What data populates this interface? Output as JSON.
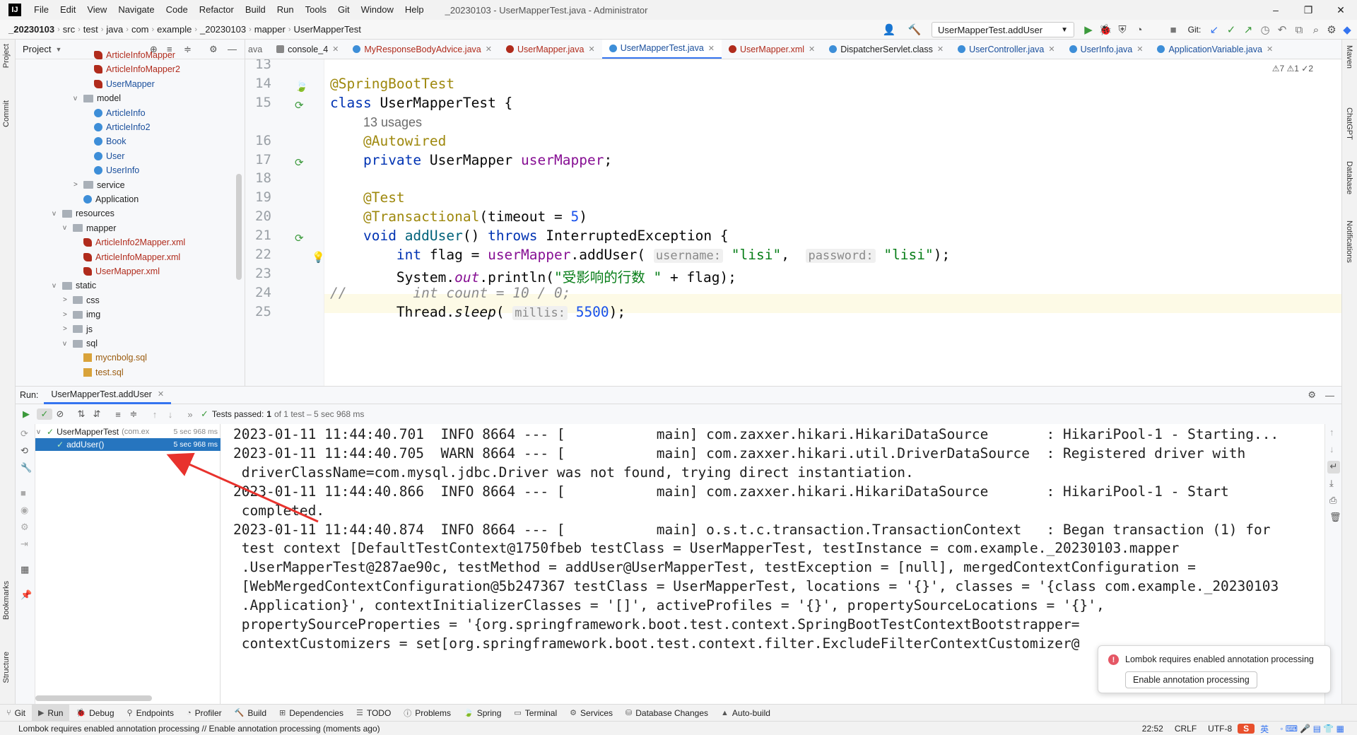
{
  "menubar": {
    "items": [
      "File",
      "Edit",
      "View",
      "Navigate",
      "Code",
      "Refactor",
      "Build",
      "Run",
      "Tools",
      "Git",
      "Window",
      "Help"
    ],
    "title": "_20230103 - UserMapperTest.java - Administrator"
  },
  "navbar": {
    "crumbs": [
      "_20230103",
      "src",
      "test",
      "java",
      "com",
      "example",
      "_20230103",
      "mapper",
      "UserMapperTest"
    ],
    "run_config": "UserMapperTest.addUser",
    "git_label": "Git:"
  },
  "left_strip": {
    "tabs": [
      "Project",
      "Commit",
      "Bookmarks",
      "Structure"
    ]
  },
  "right_strip": {
    "tabs": [
      "Maven",
      "ChatGPT",
      "Database",
      "Notifications"
    ]
  },
  "project": {
    "title": "Project",
    "tree": [
      {
        "label": "ArticleInfoMapper",
        "icon": "mybatis-icon",
        "color": "t-red",
        "indent": 3,
        "caret": ""
      },
      {
        "label": "ArticleInfoMapper2",
        "icon": "mybatis-icon",
        "color": "t-red",
        "indent": 3,
        "caret": ""
      },
      {
        "label": "UserMapper",
        "icon": "mybatis-icon",
        "color": "t-blue",
        "indent": 3,
        "caret": ""
      },
      {
        "label": "model",
        "icon": "folder-icon",
        "color": "",
        "indent": 2,
        "caret": "v"
      },
      {
        "label": "ArticleInfo",
        "icon": "class-icon",
        "color": "t-blue",
        "indent": 3,
        "caret": ""
      },
      {
        "label": "ArticleInfo2",
        "icon": "class-icon",
        "color": "t-blue",
        "indent": 3,
        "caret": ""
      },
      {
        "label": "Book",
        "icon": "class-icon",
        "color": "t-blue",
        "indent": 3,
        "caret": ""
      },
      {
        "label": "User",
        "icon": "class-icon",
        "color": "t-blue",
        "indent": 3,
        "caret": ""
      },
      {
        "label": "UserInfo",
        "icon": "class-icon",
        "color": "t-blue",
        "indent": 3,
        "caret": ""
      },
      {
        "label": "service",
        "icon": "folder-icon",
        "color": "",
        "indent": 2,
        "caret": ">"
      },
      {
        "label": "Application",
        "icon": "class-icon",
        "color": "",
        "indent": 2,
        "caret": ""
      },
      {
        "label": "resources",
        "icon": "folder-icon",
        "color": "",
        "indent": 0,
        "caret": "v"
      },
      {
        "label": "mapper",
        "icon": "folder-icon",
        "color": "",
        "indent": 1,
        "caret": "v"
      },
      {
        "label": "ArticleInfo2Mapper.xml",
        "icon": "mybatis-icon",
        "color": "t-red",
        "indent": 2,
        "caret": ""
      },
      {
        "label": "ArticleInfoMapper.xml",
        "icon": "mybatis-icon",
        "color": "t-red",
        "indent": 2,
        "caret": ""
      },
      {
        "label": "UserMapper.xml",
        "icon": "mybatis-icon",
        "color": "t-red",
        "indent": 2,
        "caret": ""
      },
      {
        "label": "static",
        "icon": "folder-icon",
        "color": "",
        "indent": 0,
        "caret": "v"
      },
      {
        "label": "css",
        "icon": "folder-icon",
        "color": "",
        "indent": 1,
        "caret": ">"
      },
      {
        "label": "img",
        "icon": "folder-icon",
        "color": "",
        "indent": 1,
        "caret": ">"
      },
      {
        "label": "js",
        "icon": "folder-icon",
        "color": "",
        "indent": 1,
        "caret": ">"
      },
      {
        "label": "sql",
        "icon": "folder-icon",
        "color": "",
        "indent": 1,
        "caret": "v"
      },
      {
        "label": "mycnbolg.sql",
        "icon": "sql-icon",
        "color": "t-orange",
        "indent": 2,
        "caret": ""
      },
      {
        "label": "test.sql",
        "icon": "sql-icon",
        "color": "t-orange",
        "indent": 2,
        "caret": ""
      }
    ]
  },
  "editor_tabs": [
    {
      "label": "console_4",
      "active": false
    },
    {
      "label": "MyResponseBodyAdvice.java",
      "active": false
    },
    {
      "label": "UserMapper.java",
      "active": false
    },
    {
      "label": "UserMapperTest.java",
      "active": true
    },
    {
      "label": "UserMapper.xml",
      "active": false
    },
    {
      "label": "DispatcherServlet.class",
      "active": false
    },
    {
      "label": "UserController.java",
      "active": false
    },
    {
      "label": "UserInfo.java",
      "active": false
    },
    {
      "label": "ApplicationVariable.java",
      "active": false
    }
  ],
  "inspections": "⚠7  ⚠1  ✓2",
  "editor": {
    "lines": [
      {
        "n": "13",
        "html": ""
      },
      {
        "n": "14",
        "html": "<span class=\"ann\">@SpringBootTest</span>"
      },
      {
        "n": "15",
        "html": "<span class=\"kw\">class</span> UserMapperTest {"
      },
      {
        "n": "",
        "html": "    <span class=\"usages\">13 usages</span>"
      },
      {
        "n": "16",
        "html": "    <span class=\"ann\">@Autowired</span>"
      },
      {
        "n": "17",
        "html": "    <span class=\"kw\">private</span> UserMapper <span class=\"fld\">userMapper</span>;"
      },
      {
        "n": "18",
        "html": ""
      },
      {
        "n": "19",
        "html": "    <span class=\"ann\">@Test</span>"
      },
      {
        "n": "20",
        "html": "    <span class=\"ann\">@Transactional</span>(timeout = <span class=\"num\">5</span>)"
      },
      {
        "n": "21",
        "html": "    <span class=\"kw\">void</span> <span class=\"fn\">addUser</span>() <span class=\"kw\">throws</span> InterruptedException {"
      },
      {
        "n": "22",
        "html": "        <span class=\"kw\">int</span> flag = <span class=\"fld\">userMapper</span>.addUser( <span class=\"hint\">username:</span> <span class=\"str\">\"lisi\"</span>,  <span class=\"hint\">password:</span> <span class=\"str\">\"lisi\"</span>);"
      },
      {
        "n": "23",
        "html": "        System.<span class=\"fld\" style=\"font-style:italic\">out</span>.println(<span class=\"str\">\"受影响的行数 \"</span> + flag);"
      },
      {
        "n": "24",
        "html": "<span class=\"comment\">//        int count = 10 / 0;</span>"
      },
      {
        "n": "25",
        "html": "        Thread.<span style=\"font-style:italic\">sleep</span>( <span class=\"hint\">millis:</span> <span class=\"num\">5500</span>);"
      }
    ]
  },
  "run": {
    "label": "Run:",
    "tab": "UserMapperTest.addUser",
    "status_prefix": "Tests passed:",
    "status_count": "1",
    "status_suffix": "of 1 test – 5 sec 968 ms",
    "tree": [
      {
        "label": "UserMapperTest",
        "sub": "(com.ex",
        "time": "5 sec 968 ms",
        "selected": false
      },
      {
        "label": "addUser()",
        "sub": "",
        "time": "5 sec 968 ms",
        "selected": true
      }
    ],
    "console": [
      "2023-01-11 11:44:40.701  INFO 8664 --- [           main] com.zaxxer.hikari.HikariDataSource       : HikariPool-1 - Starting...",
      "2023-01-11 11:44:40.705  WARN 8664 --- [           main] com.zaxxer.hikari.util.DriverDataSource  : Registered driver with",
      " driverClassName=com.mysql.jdbc.Driver was not found, trying direct instantiation.",
      "2023-01-11 11:44:40.866  INFO 8664 --- [           main] com.zaxxer.hikari.HikariDataSource       : HikariPool-1 - Start",
      " completed.",
      "2023-01-11 11:44:40.874  INFO 8664 --- [           main] o.s.t.c.transaction.TransactionContext   : Began transaction (1) for",
      " test context [DefaultTestContext@1750fbeb testClass = UserMapperTest, testInstance = com.example._20230103.mapper",
      " .UserMapperTest@287ae90c, testMethod = addUser@UserMapperTest, testException = [null], mergedContextConfiguration =",
      " [WebMergedContextConfiguration@5b247367 testClass = UserMapperTest, locations = '{}', classes = '{class com.example._20230103",
      " .Application}', contextInitializerClasses = '[]', activeProfiles = '{}', propertySourceLocations = '{}',",
      " propertySourceProperties = '{org.springframework.boot.test.context.SpringBootTestContextBootstrapper=",
      " contextCustomizers = set[org.springframework.boot.test.context.filter.ExcludeFilterContextCustomizer@"
    ]
  },
  "notification": {
    "message": "Lombok requires enabled annotation processing",
    "button": "Enable annotation processing"
  },
  "bottom_bar": [
    {
      "label": "Git",
      "icon": "git-icon",
      "active": false
    },
    {
      "label": "Run",
      "icon": "run-icon",
      "active": true
    },
    {
      "label": "Debug",
      "icon": "debug-icon",
      "active": false
    },
    {
      "label": "Endpoints",
      "icon": "endpoints-icon",
      "active": false
    },
    {
      "label": "Profiler",
      "icon": "profiler-icon",
      "active": false
    },
    {
      "label": "Build",
      "icon": "build-icon",
      "active": false
    },
    {
      "label": "Dependencies",
      "icon": "dependencies-icon",
      "active": false
    },
    {
      "label": "TODO",
      "icon": "todo-icon",
      "active": false
    },
    {
      "label": "Problems",
      "icon": "problems-icon",
      "active": false
    },
    {
      "label": "Spring",
      "icon": "spring-icon",
      "active": false
    },
    {
      "label": "Terminal",
      "icon": "terminal-icon",
      "active": false
    },
    {
      "label": "Services",
      "icon": "services-icon",
      "active": false
    },
    {
      "label": "Database Changes",
      "icon": "database-icon",
      "active": false
    },
    {
      "label": "Auto-build",
      "icon": "auto-build-icon",
      "active": false
    }
  ],
  "status_bar": {
    "message": "Lombok requires enabled annotation processing // Enable annotation processing (moments ago)",
    "position": "22:52",
    "line_sep": "CRLF",
    "encoding": "UTF-8",
    "ime": "英"
  },
  "colors": {
    "accent": "#3574f0",
    "selection": "#2675bf",
    "error": "#e55765",
    "annotation_arrow": "#e8322d"
  }
}
